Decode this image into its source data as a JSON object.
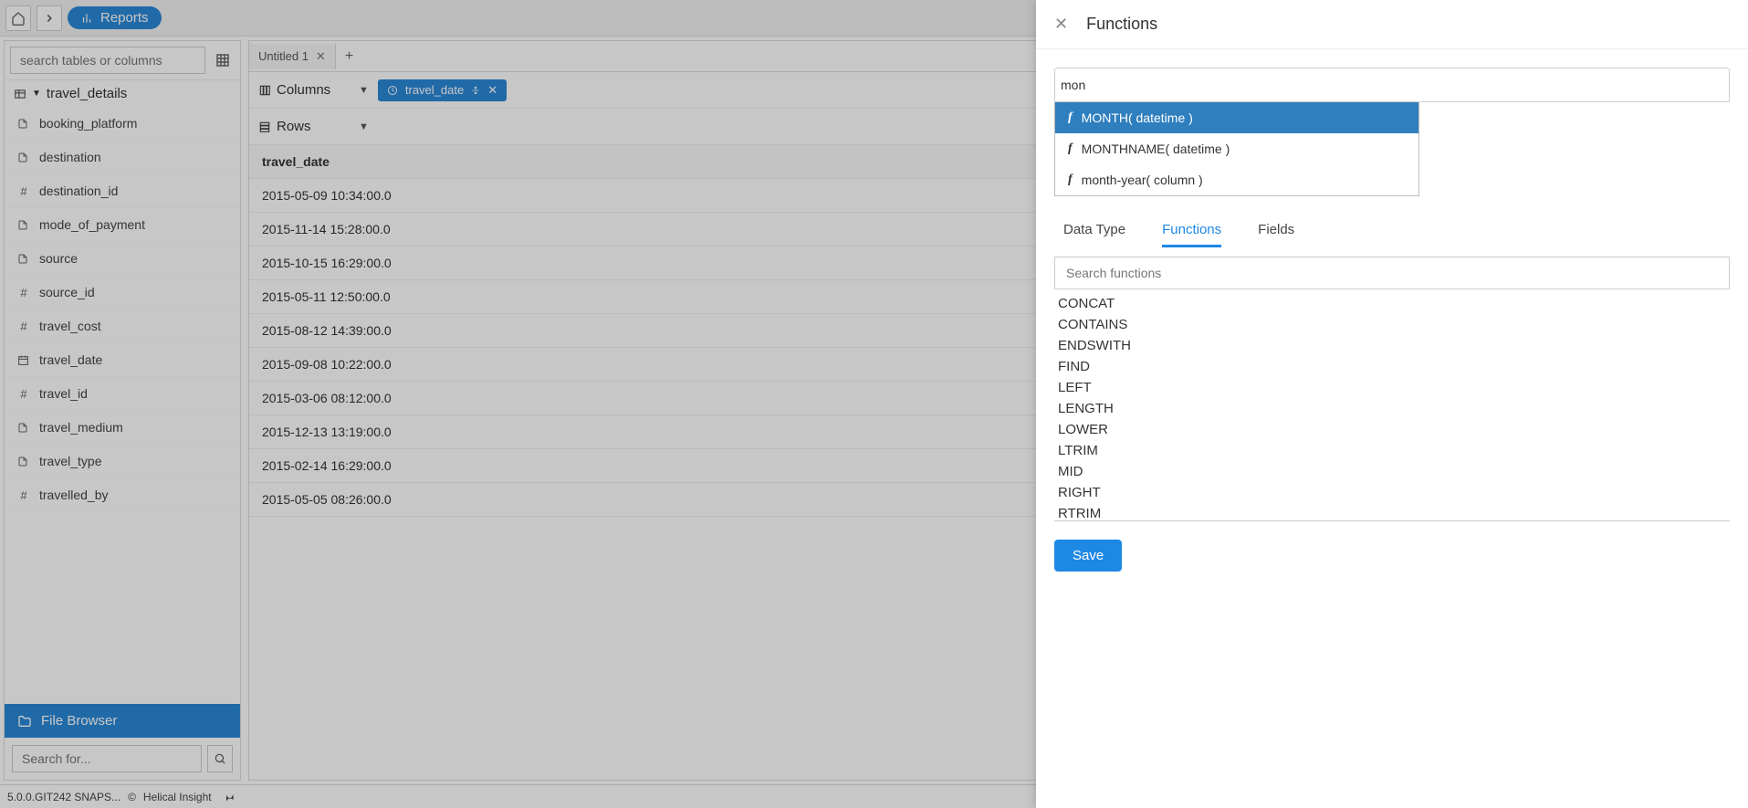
{
  "topbar": {
    "reports_label": "Reports"
  },
  "left": {
    "search_placeholder": "search tables or columns",
    "table_name": "travel_details",
    "columns": [
      {
        "icon": "doc",
        "name": "booking_platform"
      },
      {
        "icon": "doc",
        "name": "destination"
      },
      {
        "icon": "num",
        "name": "destination_id"
      },
      {
        "icon": "doc",
        "name": "mode_of_payment"
      },
      {
        "icon": "doc",
        "name": "source"
      },
      {
        "icon": "num",
        "name": "source_id"
      },
      {
        "icon": "num",
        "name": "travel_cost"
      },
      {
        "icon": "cal",
        "name": "travel_date"
      },
      {
        "icon": "num",
        "name": "travel_id"
      },
      {
        "icon": "doc",
        "name": "travel_medium"
      },
      {
        "icon": "doc",
        "name": "travel_type"
      },
      {
        "icon": "num",
        "name": "travelled_by"
      }
    ],
    "file_browser_label": "File Browser",
    "file_search_placeholder": "Search for..."
  },
  "workspace": {
    "tab_label": "Untitled 1",
    "columns_label": "Columns",
    "rows_label": "Rows",
    "chip_label": "travel_date",
    "grid_header": "travel_date",
    "rows": [
      "2015-05-09 10:34:00.0",
      "2015-11-14 15:28:00.0",
      "2015-10-15 16:29:00.0",
      "2015-05-11 12:50:00.0",
      "2015-08-12 14:39:00.0",
      "2015-09-08 10:22:00.0",
      "2015-03-06 08:12:00.0",
      "2015-12-13 13:19:00.0",
      "2015-02-14 16:29:00.0",
      "2015-05-05 08:26:00.0"
    ]
  },
  "footer": {
    "version": "5.0.0.GIT242 SNAPS...",
    "brand": "Helical Insight"
  },
  "drawer": {
    "title": "Functions",
    "formula_value": "mon",
    "suggestions": [
      "MONTH( datetime )",
      "MONTHNAME( datetime )",
      "month-year( column )"
    ],
    "tabs": {
      "datatype": "Data Type",
      "functions": "Functions",
      "fields": "Fields"
    },
    "fn_search_placeholder": "Search functions",
    "fn_list": [
      "CONCAT",
      "CONTAINS",
      "ENDSWITH",
      "FIND",
      "LEFT",
      "LENGTH",
      "LOWER",
      "LTRIM",
      "MID",
      "RIGHT",
      "RTRIM"
    ],
    "save_label": "Save"
  }
}
